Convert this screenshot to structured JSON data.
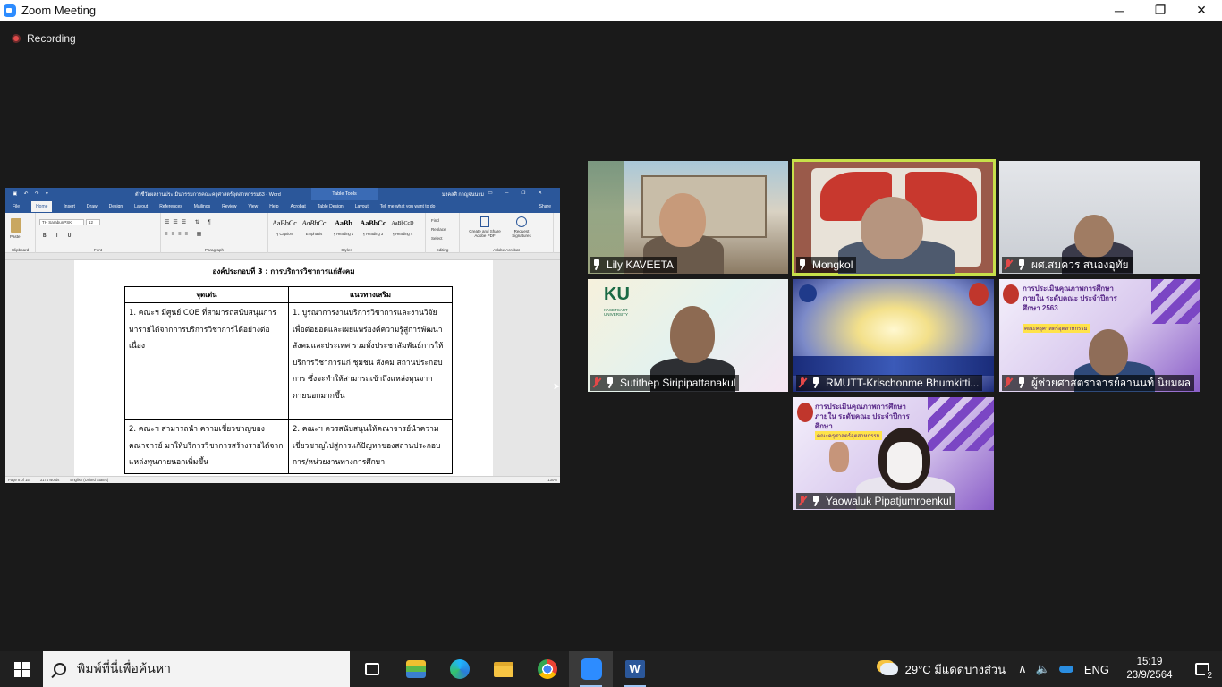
{
  "window": {
    "title": "Zoom Meeting",
    "controls": [
      "─",
      "❐",
      "✕"
    ]
  },
  "meeting": {
    "recording_label": "Recording"
  },
  "shared_document": {
    "app": "Word",
    "title_bar": "ตัวชี้วัดผลงานประเมินกรรมการคณะครุศาสตร์อุตสาหกรรม63 - Word",
    "table_tools_label": "Table Tools",
    "user_name": "มงคลศิ กาญจนนาม",
    "tabs": [
      "File",
      "Home",
      "Insert",
      "Draw",
      "Design",
      "Layout",
      "References",
      "Mailings",
      "Review",
      "View",
      "Help",
      "Acrobat",
      "Table Design",
      "Layout"
    ],
    "tell_me": "Tell me what you want to do",
    "share_label": "Share",
    "ribbon": {
      "paste": "Paste",
      "font_name": "TH SarabunPSK",
      "font_size": "12",
      "format_buttons": "B I U",
      "groups": [
        "Clipboard",
        "Font",
        "Paragraph",
        "Styles",
        "Editing",
        "Adobe Acrobat"
      ],
      "styles": [
        {
          "preview": "AaBbCc",
          "name": "¶ Caption"
        },
        {
          "preview": "AaBbCc",
          "name": "Emphasis"
        },
        {
          "preview": "AaBb",
          "name": "¶ Heading 1"
        },
        {
          "preview": "AaBbCc",
          "name": "¶ Heading 3"
        },
        {
          "preview": "AaBbCcD",
          "name": "¶ Heading 4"
        }
      ],
      "editing": [
        "Find",
        "Replace",
        "Select"
      ],
      "acrobat": [
        "Create and Share Adobe PDF",
        "Request Signatures"
      ]
    },
    "doc_title": "องค์ประกอบที่ 3 : การบริการวิชาการแก่สังคม",
    "table": {
      "headers": [
        "จุดเด่น",
        "แนวทางเสริม"
      ],
      "rows": [
        [
          "1. คณะฯ มีศูนย์ COE ที่สามารถสนับสนุนการหารายได้จากการบริการวิชาการได้อย่างต่อเนื่อง",
          "1. บูรณาการงานบริการวิชาการและงานวิจัยเพื่อต่อยอดและเผยแพร่องค์ความรู้สู่การพัฒนาสังคมและประเทศ รวมทั้งประชาสัมพันธ์การให้บริการวิชาการแก่ ชุมชน สังคม สถานประกอบการ ซึ่งจะทำให้สามารถเข้าถึงแหล่งทุนจากภายนอกมากขึ้น"
        ],
        [
          "2. คณะฯ สามารถนำ ความเชี่ยวชาญของคณาจารย์ มาให้บริการวิชาการสร้างรายได้จากแหล่งทุนภายนอกเพิ่มขึ้น",
          "2. คณะฯ ควรสนับสนุนให้คณาจารย์นำความเชี่ยวชาญไปสู่การแก้ปัญหาของสถานประกอบการ/หน่วยงานทางการศึกษา"
        ]
      ]
    },
    "status": {
      "page": "Page 8 of 15",
      "words": "3174 words",
      "language": "English (United States)",
      "zoom": "130%"
    }
  },
  "participants": [
    {
      "name": "Lily KAVEETA",
      "muted": false,
      "speaking": false
    },
    {
      "name": "Mongkol",
      "muted": false,
      "speaking": true
    },
    {
      "name": "ผศ.สมควร  สนองอุทัย",
      "muted": true,
      "speaking": false
    },
    {
      "name": "Sutithep Siripipattanakul",
      "muted": true,
      "speaking": false,
      "logo_text": "KU",
      "logo_sub": "KASETSART UNIVERSITY"
    },
    {
      "name": "RMUTT-Krischonme Bhumkitti...",
      "muted": true,
      "speaking": false
    },
    {
      "name": "ผู้ช่วยศาสตราจารย์อานนท์ นิยมผล",
      "muted": true,
      "speaking": false,
      "banner": "การประเมินคุณภาพการศึกษาภายใน ระดับคณะ ประจำปีการศึกษา 2563",
      "banner_sub": "คณะครุศาสตร์อุตสาหกรรม"
    },
    {
      "name": "Yaowaluk Pipatjumroenkul",
      "muted": true,
      "speaking": false,
      "banner": "การประเมินคุณภาพการศึกษาภายใน ระดับคณะ ประจำปีการศึกษา",
      "banner_sub": "คณะครุศาสตร์อุตสาหกรรม"
    }
  ],
  "taskbar": {
    "search_placeholder": "พิมพ์ที่นี่เพื่อค้นหา",
    "weather": "29°C  มีแดดบางส่วน",
    "language": "ENG",
    "time": "15:19",
    "date": "23/9/2564",
    "notifications": "2"
  }
}
